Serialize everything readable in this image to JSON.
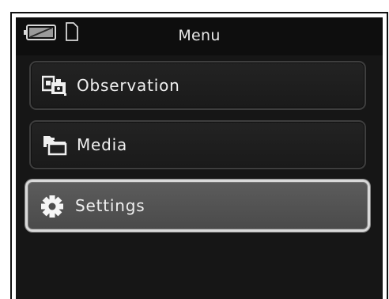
{
  "header": {
    "title": "Menu",
    "icons": [
      "battery-icon",
      "storage-card-icon"
    ]
  },
  "menu": {
    "items": [
      {
        "label": "Observation",
        "icon": "observation-icon",
        "selected": false
      },
      {
        "label": "Media",
        "icon": "media-icon",
        "selected": false
      },
      {
        "label": "Settings",
        "icon": "gear-icon",
        "selected": true
      }
    ]
  },
  "colors": {
    "screen_background": "#161616",
    "item_background": "#1f1f1f",
    "selected_background": "#525252",
    "selected_border": "#d9d9d9",
    "text": "#f0f0f0"
  }
}
